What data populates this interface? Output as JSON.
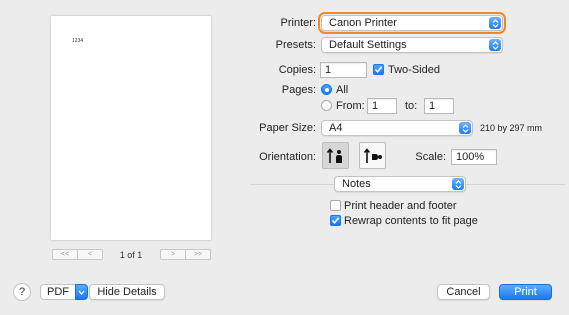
{
  "preview": {
    "page_text": "1234",
    "nav": [
      "<<",
      "<",
      ">",
      ">>"
    ],
    "page_indicator": "1 of 1"
  },
  "printer": {
    "label": "Printer:",
    "value": "Canon Printer"
  },
  "presets": {
    "label": "Presets:",
    "value": "Default Settings"
  },
  "copies": {
    "label": "Copies:",
    "value": "1",
    "two_sided_label": "Two-Sided",
    "two_sided_checked": true
  },
  "pages": {
    "label": "Pages:",
    "all_label": "All",
    "from_label": "From:",
    "from_value": "1",
    "to_label": "to:",
    "to_value": "1",
    "selected": "All"
  },
  "paper_size": {
    "label": "Paper Size:",
    "value": "A4",
    "dimensions": "210 by 297 mm"
  },
  "orientation": {
    "label": "Orientation:",
    "selected": "portrait"
  },
  "scale": {
    "label": "Scale:",
    "value": "100%"
  },
  "section": {
    "value": "Notes"
  },
  "options": {
    "print_header_footer": {
      "label": "Print header and footer",
      "checked": false
    },
    "rewrap": {
      "label": "Rewrap contents to fit page",
      "checked": true
    }
  },
  "footer": {
    "help": "?",
    "pdf": "PDF",
    "hide_details": "Hide Details",
    "cancel": "Cancel",
    "print": "Print"
  },
  "colors": {
    "accent": "#1a79f0",
    "focus": "#f08a24"
  }
}
